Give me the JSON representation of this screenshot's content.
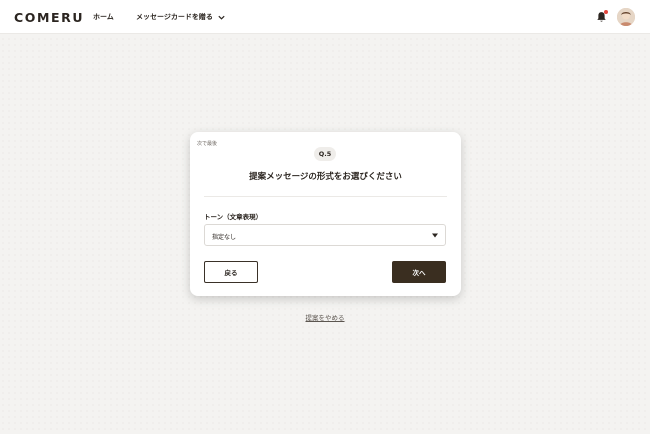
{
  "header": {
    "logo": "COMERU",
    "nav": [
      {
        "label": "ホーム"
      },
      {
        "label": "メッセージカードを贈る"
      }
    ],
    "notification_dot_color": "#e2453c",
    "icons": {
      "notification": "bell-icon",
      "dropdown": "chevron-down-icon",
      "user": "avatar"
    }
  },
  "card": {
    "step_note": "次で最後",
    "question_badge": "Q.5",
    "question_title": "提案メッセージの形式をお選びください",
    "field_label": "トーン（文章表現）",
    "select": {
      "value": "指定なし"
    },
    "back_button": "戻る",
    "next_button": "次へ"
  },
  "footer_link": "提案をやめる",
  "colors": {
    "primary": "#3a2e20",
    "background": "#f4f3f1",
    "text": "#2b2520"
  }
}
